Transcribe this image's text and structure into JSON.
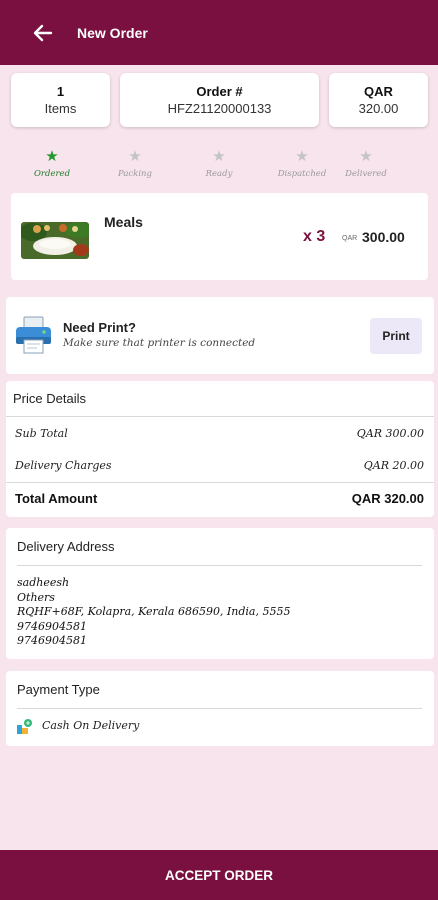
{
  "appbar": {
    "title": "New Order",
    "back_icon": "arrow-left-icon"
  },
  "summary": {
    "items": {
      "count": "1",
      "label": "Items"
    },
    "order": {
      "label": "Order #",
      "number": "HFZ21120000133"
    },
    "total": {
      "currency": "QAR",
      "amount": "320.00"
    }
  },
  "status_steps": [
    {
      "label": "Ordered",
      "active": true
    },
    {
      "label": "Packing",
      "active": false
    },
    {
      "label": "Ready",
      "active": false
    },
    {
      "label": "Dispatched",
      "active": false
    },
    {
      "label": "Delivered",
      "active": false
    }
  ],
  "order_item": {
    "name": "Meals",
    "quantity": "x 3",
    "currency": "QAR",
    "price": "300.00"
  },
  "print": {
    "title": "Need Print?",
    "subtitle": "Make sure that printer is connected",
    "button": "Print"
  },
  "price_details": {
    "title": "Price Details",
    "rows": [
      {
        "label": "Sub Total",
        "value": "QAR 300.00"
      },
      {
        "label": "Delivery Charges",
        "value": "QAR 20.00"
      }
    ],
    "total_label": "Total Amount",
    "total_value": "QAR 320.00"
  },
  "delivery_address": {
    "title": "Delivery Address",
    "lines": [
      "sadheesh",
      "Others",
      "RQHF+68F, Kolapra, Kerala 686590, India, 5555",
      "9746904581",
      "9746904581"
    ]
  },
  "payment": {
    "title": "Payment Type",
    "method": "Cash On Delivery"
  },
  "footer": {
    "accept_label": "ACCEPT ORDER"
  },
  "colors": {
    "brand": "#7a1040",
    "background": "#f8e4ec",
    "active_step": "#1f9a2c"
  }
}
